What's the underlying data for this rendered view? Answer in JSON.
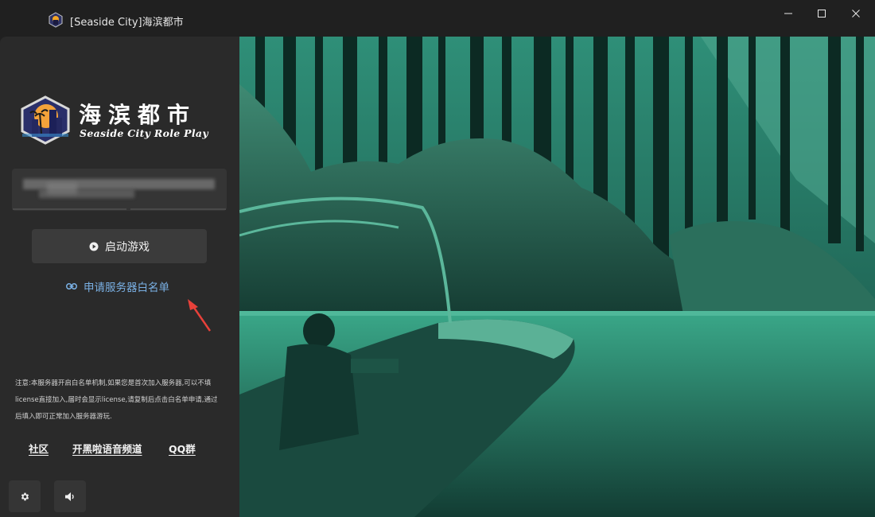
{
  "window": {
    "title": "[Seaside City]海滨都市",
    "controls": [
      "minimize-icon",
      "maximize-icon",
      "close-icon"
    ]
  },
  "logo": {
    "title_cn": "海滨都市",
    "subtitle_en": "Seaside City Role Play"
  },
  "license_input": {
    "value": "",
    "value_obscured": true
  },
  "launch_button": {
    "label": "启动游戏",
    "icon": "play-circle-icon"
  },
  "whitelist_link": {
    "label": "申请服务器白名单",
    "icon": "link-icon"
  },
  "notice": {
    "text": "注意:本服务器开启白名单机制,如果您是首次加入服务器,可以不填license直接加入,届时会显示license,请复制后点击白名单申请,通过后填入即可正常加入服务器游玩."
  },
  "footer_links": [
    {
      "label": "社区"
    },
    {
      "label": "开黑啦语音频道"
    },
    {
      "label": "QQ群"
    }
  ],
  "footer_buttons": [
    {
      "icon": "gear-icon"
    },
    {
      "icon": "speaker-icon"
    }
  ],
  "colors": {
    "background": "#202020",
    "panel": "#2a2a2a",
    "button": "#3b3b3b",
    "link": "#7ab0e4",
    "annotation_arrow": "#e8413a",
    "hero_tint": "#2a9c82"
  }
}
